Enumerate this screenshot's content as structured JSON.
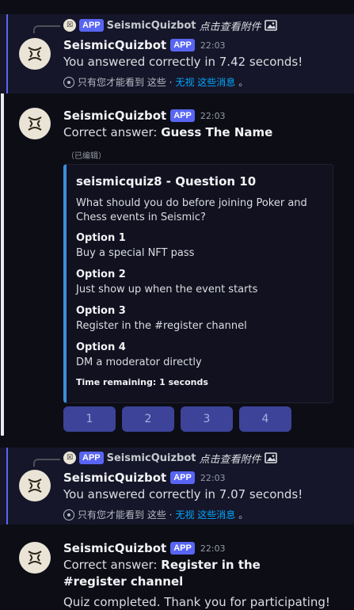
{
  "bot": {
    "name": "SeismicQuizbot",
    "app_badge": "APP"
  },
  "messages": [
    {
      "reply_text": "点击查看附件",
      "time": "22:03",
      "content": "You answered correctly in 7.42 seconds!",
      "note_prefix": "只有您才能看到 这些 ·",
      "note_link": "无视 这些消息",
      "note_suffix": "。"
    },
    {
      "time": "22:03",
      "content_prefix": "Correct answer:",
      "content_bold": "Guess The Name",
      "edited": "（已编辑）",
      "embed": {
        "title": "seismicquiz8 - Question 10",
        "description": "What should you do before joining Poker and Chess events in Seismic?",
        "fields": [
          {
            "name": "Option 1",
            "value": "Buy a special NFT pass"
          },
          {
            "name": "Option 2",
            "value": "Just show up when the event starts"
          },
          {
            "name": "Option 3",
            "value": "Register in the #register channel"
          },
          {
            "name": "Option 4",
            "value": "DM a moderator directly"
          }
        ],
        "footer": "Time remaining: 1 seconds"
      },
      "buttons": [
        "1",
        "2",
        "3",
        "4"
      ]
    },
    {
      "reply_text": "点击查看附件",
      "time": "22:03",
      "content": "You answered correctly in 7.07 seconds!",
      "note_prefix": "只有您才能看到 这些 ·",
      "note_link": "无视 这些消息",
      "note_suffix": "。"
    },
    {
      "time": "22:03",
      "content_prefix": "Correct answer:",
      "content_bold": "Register in the #register channel",
      "content_line2": "Quiz completed. Thank you for participating!"
    }
  ],
  "colors": {
    "background": "#0d0d16",
    "ephemeral_background": "#16162a",
    "accent": "#5865f2",
    "embed_border": "#3b8fd9",
    "button": "#3c4399",
    "link": "#00a8fc"
  }
}
